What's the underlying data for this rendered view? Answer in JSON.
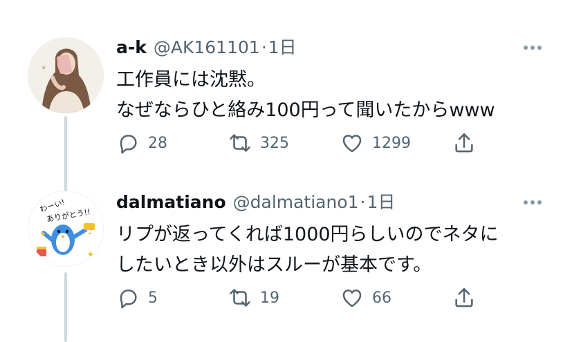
{
  "tweets": [
    {
      "display_name": "a-k",
      "handle": "@AK161101",
      "separator": "·",
      "time": "1日",
      "text_lines": [
        "工作員には沈黙。",
        "なぜならひと絡み100円って聞いたからwww"
      ],
      "replies": "28",
      "retweets": "325",
      "likes": "1299"
    },
    {
      "display_name": "dalmatiano",
      "handle": "@dalmatiano1",
      "separator": "·",
      "time": "1日",
      "text_lines": [
        "リプが返ってくれば1000円らしいのでネタに",
        "したいとき以外はスルーが基本です。"
      ],
      "replies": "5",
      "retweets": "19",
      "likes": "66"
    }
  ],
  "icons": {
    "reply": "reply-icon",
    "retweet": "retweet-icon",
    "like": "heart-icon",
    "share": "share-icon",
    "more": "more-options-icon"
  },
  "colors": {
    "text": "#0f1419",
    "secondary": "#536471",
    "thread_line": "#cfd9de",
    "icon": "#536471"
  }
}
